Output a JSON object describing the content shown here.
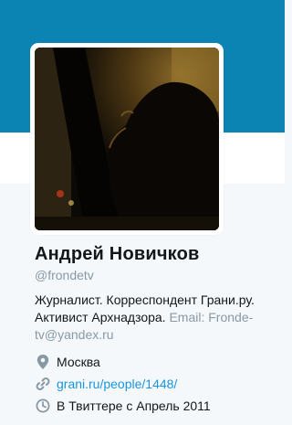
{
  "profile": {
    "name": "Андрей Новичков",
    "handle": "@frondetv",
    "bio": {
      "text_lines": [
        "Журналист. Корреспондент Грани.ру.",
        "Активист Архнадзора. "
      ],
      "email_line1": "Email: Fronde-",
      "email_line2": "tv@yandex.ru"
    },
    "location": "Москва",
    "website": "grani.ru/people/1448/",
    "joined": "В Твиттере с Апрель 2011"
  },
  "colors": {
    "banner": "#0b84b4",
    "link": "#1b95e0",
    "muted": "#8899a6",
    "text": "#14171a",
    "page_bg": "#f5f8fa"
  },
  "icons": {
    "location": "map-pin-icon",
    "website": "link-icon",
    "joined": "clock-icon"
  }
}
